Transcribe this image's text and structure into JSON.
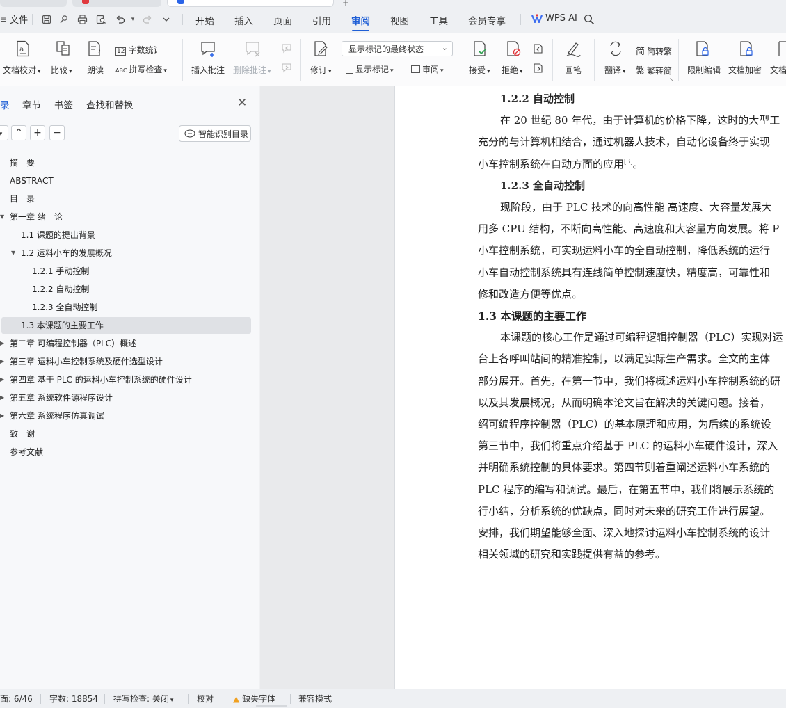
{
  "titlebar": {
    "file_label": "文件"
  },
  "menu": {
    "tabs": [
      {
        "label": "开始"
      },
      {
        "label": "插入"
      },
      {
        "label": "页面"
      },
      {
        "label": "引用"
      },
      {
        "label": "审阅",
        "active": true
      },
      {
        "label": "视图"
      },
      {
        "label": "工具"
      },
      {
        "label": "会员专享"
      }
    ],
    "wps_ai_label": "WPS AI"
  },
  "ribbon": {
    "doc_check": "文档校对",
    "compare": "比较",
    "read_aloud": "朗读",
    "word_count": "字数统计",
    "spell_check": "拼写检查",
    "insert_comment": "插入批注",
    "delete_comment": "删除批注",
    "track_changes": "修订",
    "markup_state": "显示标记的最终状态",
    "show_markup": "显示标记",
    "review": "审阅",
    "accept": "接受",
    "reject": "拒绝",
    "pen": "画笔",
    "translate": "翻译",
    "to_traditional": "简转繁",
    "to_simplified": "繁转简",
    "restrict_edit": "限制编辑",
    "encrypt": "文档加密",
    "doc_more": "文档"
  },
  "nav": {
    "tabs": [
      {
        "label": "录",
        "active": true
      },
      {
        "label": "章节"
      },
      {
        "label": "书签"
      },
      {
        "label": "查找和替换"
      }
    ],
    "smart_toc": "智能识别目录",
    "toc": [
      {
        "text": "摘　要"
      },
      {
        "text": "ABSTRACT"
      },
      {
        "text": "目　录"
      },
      {
        "text": "第一章  绪　论",
        "expanded": true
      },
      {
        "text": "1.1  课题的提出背景"
      },
      {
        "text": "1.2  运料小车的发展概况",
        "expanded": true
      },
      {
        "text": "1.2.1  手动控制"
      },
      {
        "text": "1.2.2  自动控制"
      },
      {
        "text": "1.2.3  全自动控制"
      },
      {
        "text": "1.3  本课题的主要工作",
        "selected": true
      },
      {
        "text": "第二章  可编程控制器（PLC）概述"
      },
      {
        "text": "第三章  运料小车控制系统及硬件选型设计"
      },
      {
        "text": "第四章  基于 PLC 的运料小车控制系统的硬件设计"
      },
      {
        "text": "第五章  系统软件源程序设计"
      },
      {
        "text": "第六章  系统程序仿真调试"
      },
      {
        "text": "致　谢"
      },
      {
        "text": "参考文献"
      }
    ]
  },
  "document": {
    "heading_badge": "H2",
    "lines": [
      {
        "text": "1.2.2 自动控制",
        "style": "h3"
      },
      {
        "text": "在 20 世纪 80 年代，由于计算机的价格下降，这时的大型工",
        "style": "indent"
      },
      {
        "text": "充分的与计算机相结合，通过机器人技术，自动化设备终于实现",
        "style": "body"
      },
      {
        "text": "小车控制系统在自动方面的应用",
        "style": "body",
        "sup": "[3]",
        "after": "。"
      },
      {
        "text": "1.2.3 全自动控制",
        "style": "h3"
      },
      {
        "text": "现阶段，由于 PLC 技术的向高性能  高速度、大容量发展大",
        "style": "indent"
      },
      {
        "text": "用多 CPU 结构，不断向高性能、高速度和大容量方向发展。将 P",
        "style": "body"
      },
      {
        "text": "小车控制系统，可实现运料小车的全自动控制，降低系统的运行",
        "style": "body"
      },
      {
        "text": "小车自动控制系统具有连线简单控制速度快，精度高，可靠性和",
        "style": "body"
      },
      {
        "text": "修和改造方便等优点。",
        "style": "body"
      },
      {
        "text": "1.3  本课题的主要工作",
        "style": "h2"
      },
      {
        "text": "本课题的核心工作是通过可编程逻辑控制器（PLC）实现对运",
        "style": "indent"
      },
      {
        "text": "台上各呼叫站间的精准控制，以满足实际生产需求。全文的主体",
        "style": "body"
      },
      {
        "text": "部分展开。首先，在第一节中，我们将概述运料小车控制系统的研",
        "style": "body"
      },
      {
        "text": "以及其发展概况，从而明确本论文旨在解决的关键问题。接着，",
        "style": "body"
      },
      {
        "text": "绍可编程序控制器（PLC）的基本原理和应用，为后续的系统设",
        "style": "body"
      },
      {
        "text": "第三节中，我们将重点介绍基于 PLC 的运料小车硬件设计，深入",
        "style": "body"
      },
      {
        "text": "并明确系统控制的具体要求。第四节则着重阐述运料小车系统的",
        "style": "body"
      },
      {
        "text": "PLC 程序的编写和调试。最后，在第五节中，我们将展示系统的",
        "style": "body"
      },
      {
        "text": "行小结，分析系统的优缺点，同时对未来的研究工作进行展望。",
        "style": "body"
      },
      {
        "text": "安排，我们期望能够全面、深入地探讨运料小车控制系统的设计",
        "style": "body"
      },
      {
        "text": "相关领域的研究和实践提供有益的参考。",
        "style": "body"
      }
    ]
  },
  "status": {
    "page": "面: 6/46",
    "words": "字数: 18854",
    "spell": "拼写检查: 关闭",
    "proof": "校对",
    "missing_font": "缺失字体",
    "compat": "兼容模式"
  },
  "colors": {
    "accent": "#1f5fd6",
    "warning": "#f0a020"
  }
}
